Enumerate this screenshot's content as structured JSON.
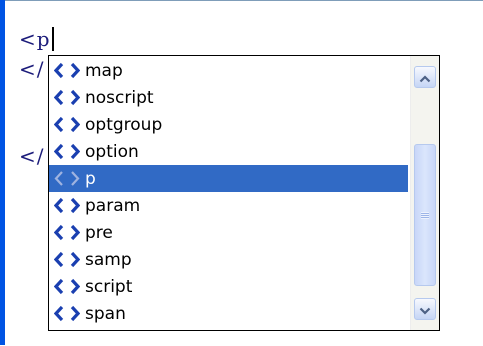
{
  "editor": {
    "lines": [
      {
        "text": "<p"
      },
      {
        "text": "</"
      },
      {
        "text": "</"
      }
    ]
  },
  "autocomplete": {
    "items": [
      {
        "label": "map",
        "icon": "tag-icon"
      },
      {
        "label": "noscript",
        "icon": "tag-icon"
      },
      {
        "label": "optgroup",
        "icon": "tag-icon"
      },
      {
        "label": "option",
        "icon": "tag-icon"
      },
      {
        "label": "p",
        "icon": "tag-icon"
      },
      {
        "label": "param",
        "icon": "tag-icon"
      },
      {
        "label": "pre",
        "icon": "tag-icon"
      },
      {
        "label": "samp",
        "icon": "tag-icon"
      },
      {
        "label": "script",
        "icon": "tag-icon"
      },
      {
        "label": "span",
        "icon": "tag-icon"
      }
    ],
    "selected_label": "p"
  },
  "colors": {
    "window_border": "#0054e3",
    "selection": "#316ac5",
    "tag_icon": "#1a3fb0",
    "code_text": "#1b1b7a"
  }
}
